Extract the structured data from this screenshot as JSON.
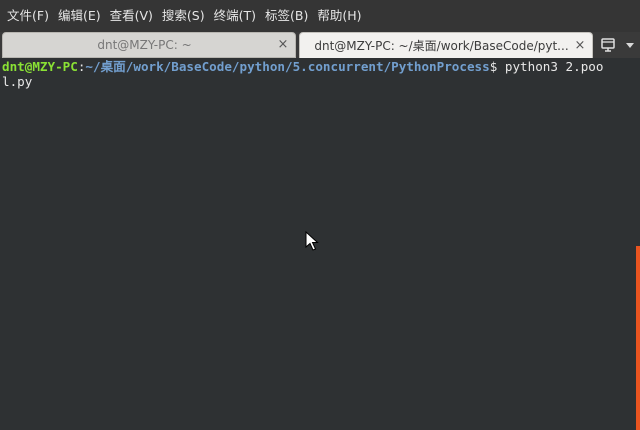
{
  "menubar": {
    "items": [
      {
        "label": "文件(F)"
      },
      {
        "label": "编辑(E)"
      },
      {
        "label": "查看(V)"
      },
      {
        "label": "搜索(S)"
      },
      {
        "label": "终端(T)"
      },
      {
        "label": "标签(B)"
      },
      {
        "label": "帮助(H)"
      }
    ]
  },
  "tabs": [
    {
      "title": "dnt@MZY-PC: ~",
      "close": "×",
      "active": false
    },
    {
      "title": "dnt@MZY-PC: ~/桌面/work/BaseCode/pyt...",
      "close": "×",
      "active": true
    }
  ],
  "tabbar": {
    "new_tab_icon": "new-tab-icon",
    "menu_icon": "chevron-down-icon"
  },
  "terminal": {
    "prompt_user": "dnt@MZY-PC",
    "prompt_sep": ":",
    "prompt_path": "~/桌面/work/BaseCode/python/5.concurrent/PythonProcess",
    "prompt_symbol": "$ ",
    "command_part1": "python3 2.poo",
    "command_part2": "l.py"
  },
  "colors": {
    "prompt_user": "#8ae234",
    "prompt_path": "#729fcf",
    "scrollbar_thumb": "#e95420",
    "background": "#2e3133"
  }
}
